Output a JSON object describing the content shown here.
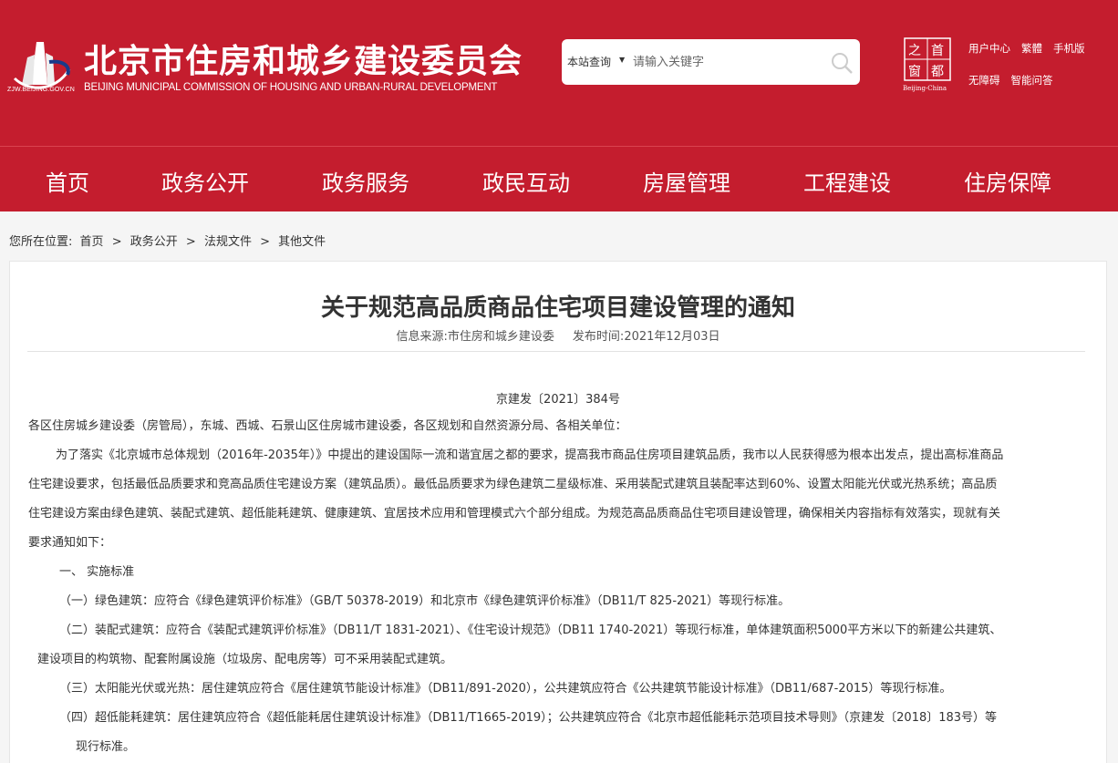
{
  "header": {
    "logo_url": "ZJW.BEIJING.GOV.CN",
    "title": "北京市住房和城乡建设委员会",
    "subtitle": "BEIJING MUNICIPAL COMMISSION OF HOUSING AND URBAN-RURAL DEVELOPMENT",
    "search_scope": "本站查询",
    "search_placeholder": "请输入关键字",
    "capital_window_chars": [
      "首",
      "都",
      "之",
      "窗"
    ],
    "capital_window_caption": "Beijing-China",
    "links_row1": [
      "用户中心",
      "繁體",
      "手机版"
    ],
    "links_row2": [
      "无障碍",
      "智能问答"
    ],
    "brand_red": "#c41d2e"
  },
  "nav": {
    "items": [
      "首页",
      "政务公开",
      "政务服务",
      "政民互动",
      "房屋管理",
      "工程建设",
      "住房保障"
    ]
  },
  "breadcrumb": {
    "prefix": "您所在位置:",
    "items": [
      "首页",
      "政务公开",
      "法规文件",
      "其他文件"
    ],
    "separator": ">"
  },
  "article": {
    "title": "关于规范高品质商品住宅项目建设管理的通知",
    "source_label": "信息来源:",
    "source": "市住房和城乡建设委",
    "date_label": "发布时间:",
    "date": "2021年12月03日",
    "doc_number": "京建发〔2021〕384号",
    "lines": [
      "各区住房城乡建设委（房管局），东城、西城、石景山区住房城市建设委，各区规划和自然资源分局、各相关单位：",
      "为了落实《北京城市总体规划（2016年-2035年）》中提出的建设国际一流和谐宜居之都的要求，提高我市商品住房项目建筑品质，我市以人民获得感为根本出发点，提出高标准商品",
      "住宅建设要求，包括最低品质要求和竞高品质住宅建设方案（建筑品质）。最低品质要求为绿色建筑二星级标准、采用装配式建筑且装配率达到60%、设置太阳能光伏或光热系统；高品质",
      "住宅建设方案由绿色建筑、装配式建筑、超低能耗建筑、健康建筑、宜居技术应用和管理模式六个部分组成。为规范高品质商品住宅项目建设管理，确保相关内容指标有效落实，现就有关",
      "要求通知如下：",
      "一、 实施标准",
      "（一）绿色建筑：应符合《绿色建筑评价标准》（GB/T 50378-2019）和北京市《绿色建筑评价标准》（DB11/T 825-2021）等现行标准。",
      "（二）装配式建筑：应符合《装配式建筑评价标准》（DB11/T 1831-2021）、《住宅设计规范》（DB11 1740-2021）等现行标准，单体建筑面积5000平方米以下的新建公共建筑、",
      "建设项目的构筑物、配套附属设施（垃圾房、配电房等）可不采用装配式建筑。",
      "（三）太阳能光伏或光热：居住建筑应符合《居住建筑节能设计标准》（DB11/891-2020），公共建筑应符合《公共建筑节能设计标准》（DB11/687-2015）等现行标准。",
      "（四）超低能耗建筑：居住建筑应符合《超低能耗居住建筑设计标准》（DB11/T1665-2019）；公共建筑应符合《北京市超低能耗示范项目技术导则》（京建发〔2018〕183号）等",
      "现行标准。"
    ]
  }
}
